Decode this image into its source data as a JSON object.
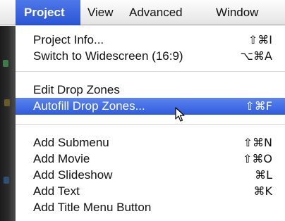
{
  "menubar": {
    "items": [
      {
        "label": "Project",
        "active": true
      },
      {
        "label": "View",
        "active": false
      },
      {
        "label": "Advanced",
        "active": false
      },
      {
        "label": "Window",
        "active": false
      }
    ]
  },
  "menu": {
    "items": [
      {
        "label": "Project Info...",
        "shortcut": "⇧⌘I"
      },
      {
        "label": "Switch to Widescreen (16:9)",
        "shortcut": "⌥⌘A"
      },
      {
        "label": "Edit Drop Zones",
        "shortcut": ""
      },
      {
        "label": "Autofill Drop Zones...",
        "shortcut": "⇧⌘F",
        "highlighted": true
      },
      {
        "label": "Add Submenu",
        "shortcut": "⇧⌘N"
      },
      {
        "label": "Add Movie",
        "shortcut": "⇧⌘O"
      },
      {
        "label": "Add Slideshow",
        "shortcut": "⌘L"
      },
      {
        "label": "Add Text",
        "shortcut": "⌘K"
      },
      {
        "label": "Add Title Menu Button",
        "shortcut": ""
      }
    ]
  },
  "colors": {
    "highlight": "#3a65df",
    "menubar_active": "#3a63dc",
    "separator": "#d6d6d6"
  },
  "icons": {
    "cursor": "arrow-cursor-icon"
  }
}
